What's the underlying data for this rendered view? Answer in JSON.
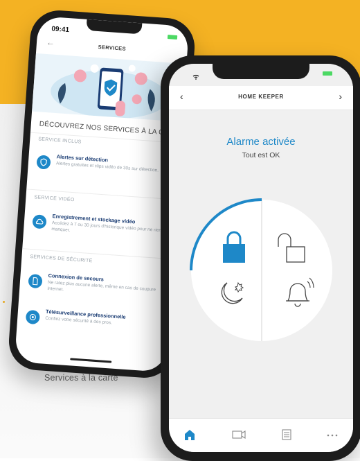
{
  "caption": "Services à la carte",
  "services_screen": {
    "time": "09:41",
    "back_icon": "arrow-left-icon",
    "title": "SERVICES",
    "heading": "DÉCOUVREZ NOS SERVICES À LA CARTE",
    "sections": [
      {
        "label": "SERVICE INCLUS",
        "items": [
          {
            "icon": "shield-icon",
            "title": "Alertes sur détection",
            "desc": "Alertes gratuites et clips vidéo de 30s sur détection."
          }
        ]
      },
      {
        "label": "SERVICE VIDÉO",
        "items": [
          {
            "icon": "cloud-icon",
            "title": "Enregistrement et stockage vidéo",
            "desc": "Accédez à 7 ou 30 jours d'historique vidéo pour ne rien manquer."
          }
        ]
      },
      {
        "label": "SERVICES DE SÉCURITÉ",
        "items": [
          {
            "icon": "sim-icon",
            "title": "Connexion de secours",
            "desc": "Ne ratez plus aucune alerte, même en cas de coupure Internet."
          },
          {
            "icon": "camera-icon",
            "title": "Télésurveillance professionnelle",
            "desc": "Confiez votre sécurité à des pros."
          }
        ]
      }
    ]
  },
  "home_keeper_screen": {
    "title": "HOME KEEPER",
    "back_icon": "chevron-left-icon",
    "forward_icon": "chevron-right-icon",
    "status": "Alarme activée",
    "substatus": "Tout est OK",
    "modes": [
      {
        "name": "lock-closed-icon",
        "active": true
      },
      {
        "name": "lock-open-icon",
        "active": false
      },
      {
        "name": "night-mode-icon",
        "active": false
      },
      {
        "name": "bell-icon",
        "active": false
      }
    ],
    "tabs": [
      {
        "name": "home-icon",
        "active": true
      },
      {
        "name": "video-icon",
        "active": false
      },
      {
        "name": "list-icon",
        "active": false
      },
      {
        "name": "more-icon",
        "active": false
      }
    ]
  },
  "colors": {
    "accent": "#1e88c8",
    "brand_yellow": "#f4b223",
    "navy": "#1a3c73"
  }
}
